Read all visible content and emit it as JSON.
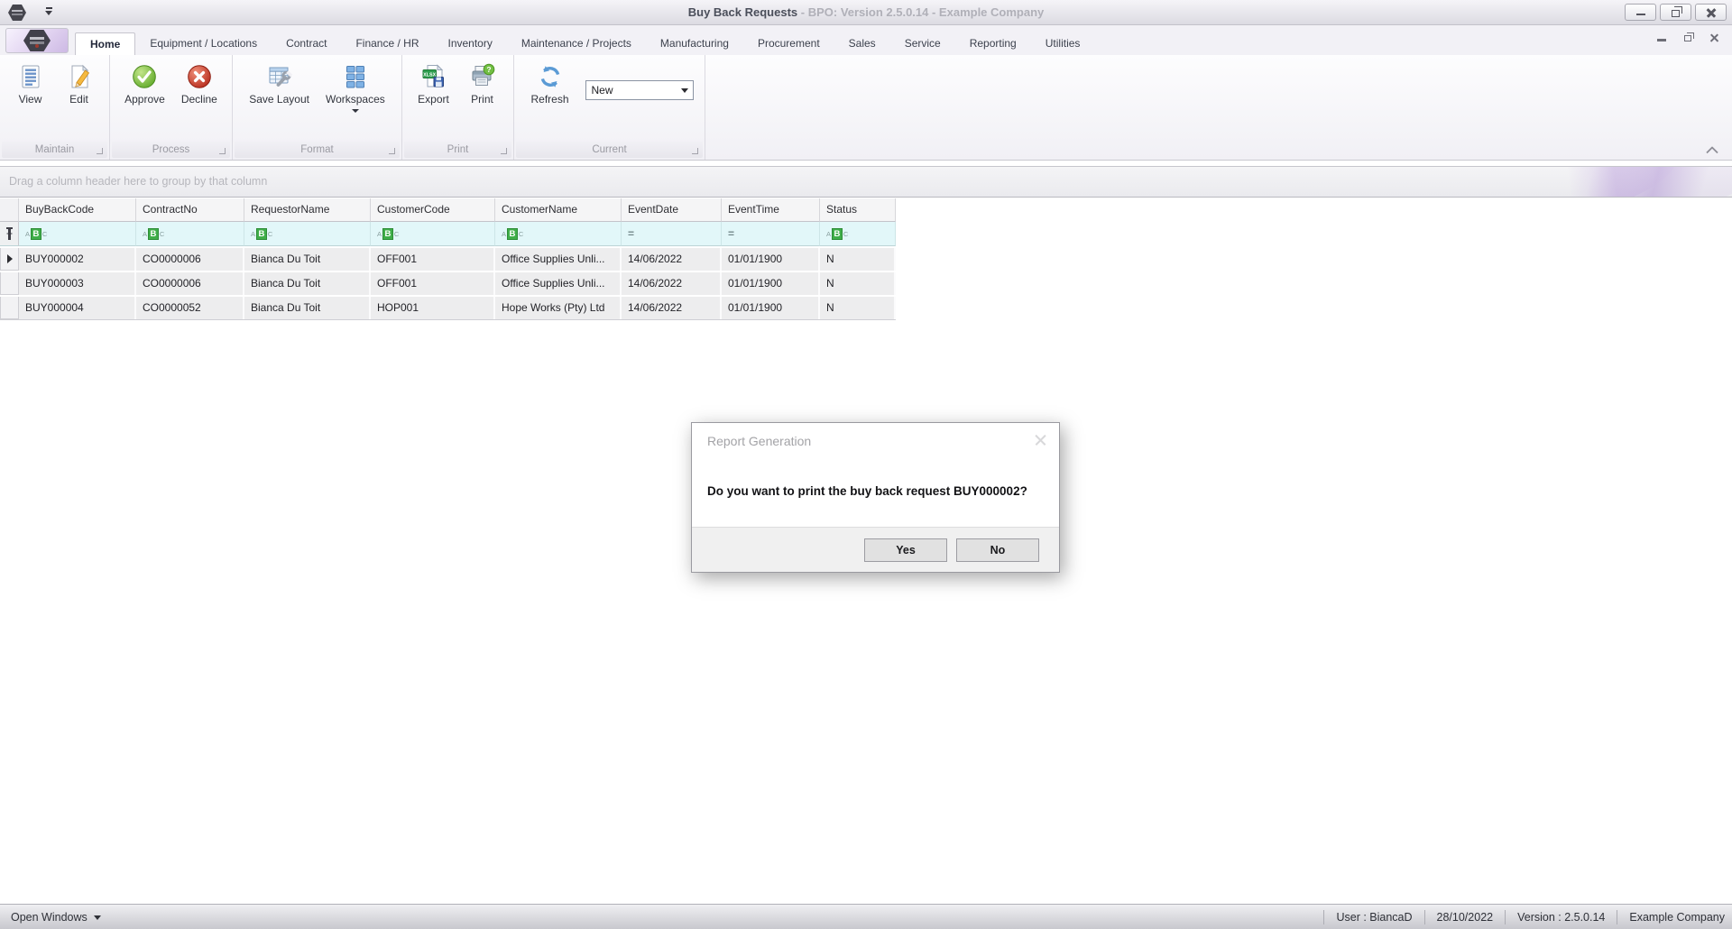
{
  "titlebar": {
    "title_primary": "Buy Back Requests",
    "title_secondary": "- BPO: Version 2.5.0.14 - Example Company"
  },
  "tabs": {
    "items": [
      {
        "label": "Home",
        "active": true
      },
      {
        "label": "Equipment / Locations"
      },
      {
        "label": "Contract"
      },
      {
        "label": "Finance / HR"
      },
      {
        "label": "Inventory"
      },
      {
        "label": "Maintenance / Projects"
      },
      {
        "label": "Manufacturing"
      },
      {
        "label": "Procurement"
      },
      {
        "label": "Sales"
      },
      {
        "label": "Service"
      },
      {
        "label": "Reporting"
      },
      {
        "label": "Utilities"
      }
    ]
  },
  "ribbon": {
    "groups": [
      {
        "label": "Maintain",
        "buttons": [
          {
            "label": "View",
            "icon": "view-icon"
          },
          {
            "label": "Edit",
            "icon": "edit-icon"
          }
        ]
      },
      {
        "label": "Process",
        "buttons": [
          {
            "label": "Approve",
            "icon": "approve-icon"
          },
          {
            "label": "Decline",
            "icon": "decline-icon"
          }
        ]
      },
      {
        "label": "Format",
        "buttons": [
          {
            "label": "Save Layout",
            "icon": "save-layout-icon"
          },
          {
            "label": "Workspaces",
            "icon": "workspaces-icon",
            "has_dropdown": true
          }
        ]
      },
      {
        "label": "Print",
        "buttons": [
          {
            "label": "Export",
            "icon": "export-icon"
          },
          {
            "label": "Print",
            "icon": "print-icon"
          }
        ]
      },
      {
        "label": "Current",
        "buttons": [
          {
            "label": "Refresh",
            "icon": "refresh-icon"
          }
        ],
        "combo_value": "New"
      }
    ],
    "icon_badges": {
      "export_badge": "XLSX",
      "print_badge": "?"
    }
  },
  "grid": {
    "group_hint": "Drag a column header here to group by that column",
    "columns": [
      "BuyBackCode",
      "ContractNo",
      "RequestorName",
      "CustomerCode",
      "CustomerName",
      "EventDate",
      "EventTime",
      "Status"
    ],
    "filter_row": {
      "abc": {
        "a": "A",
        "b": "B",
        "c": "C"
      },
      "equals_glyph": "=",
      "types": [
        "text",
        "text",
        "text",
        "text",
        "text",
        "equals",
        "equals",
        "text"
      ]
    },
    "rows": [
      {
        "selected": true,
        "cells": [
          "BUY000002",
          "CO0000006",
          "Bianca Du Toit",
          "OFF001",
          "Office Supplies Unli...",
          "14/06/2022",
          "01/01/1900",
          "N"
        ]
      },
      {
        "selected": false,
        "cells": [
          "BUY000003",
          "CO0000006",
          "Bianca Du Toit",
          "OFF001",
          "Office Supplies Unli...",
          "14/06/2022",
          "01/01/1900",
          "N"
        ]
      },
      {
        "selected": false,
        "cells": [
          "BUY000004",
          "CO0000052",
          "Bianca Du Toit",
          "HOP001",
          "Hope Works (Pty) Ltd",
          "14/06/2022",
          "01/01/1900",
          "N"
        ]
      }
    ]
  },
  "dialog": {
    "title": "Report Generation",
    "message": "Do you want to print the buy back request BUY000002?",
    "yes_label": "Yes",
    "no_label": "No"
  },
  "statusbar": {
    "open_windows": "Open Windows",
    "user": "User : BiancaD",
    "date": "28/10/2022",
    "version": "Version : 2.5.0.14",
    "company": "Example Company"
  },
  "colors": {
    "approve_green": "#5fa928",
    "decline_red": "#b5291a",
    "filter_row_bg": "#e2f7f9",
    "filter_badge_green": "#3fae49",
    "refresh_blue": "#5b9bd5"
  }
}
